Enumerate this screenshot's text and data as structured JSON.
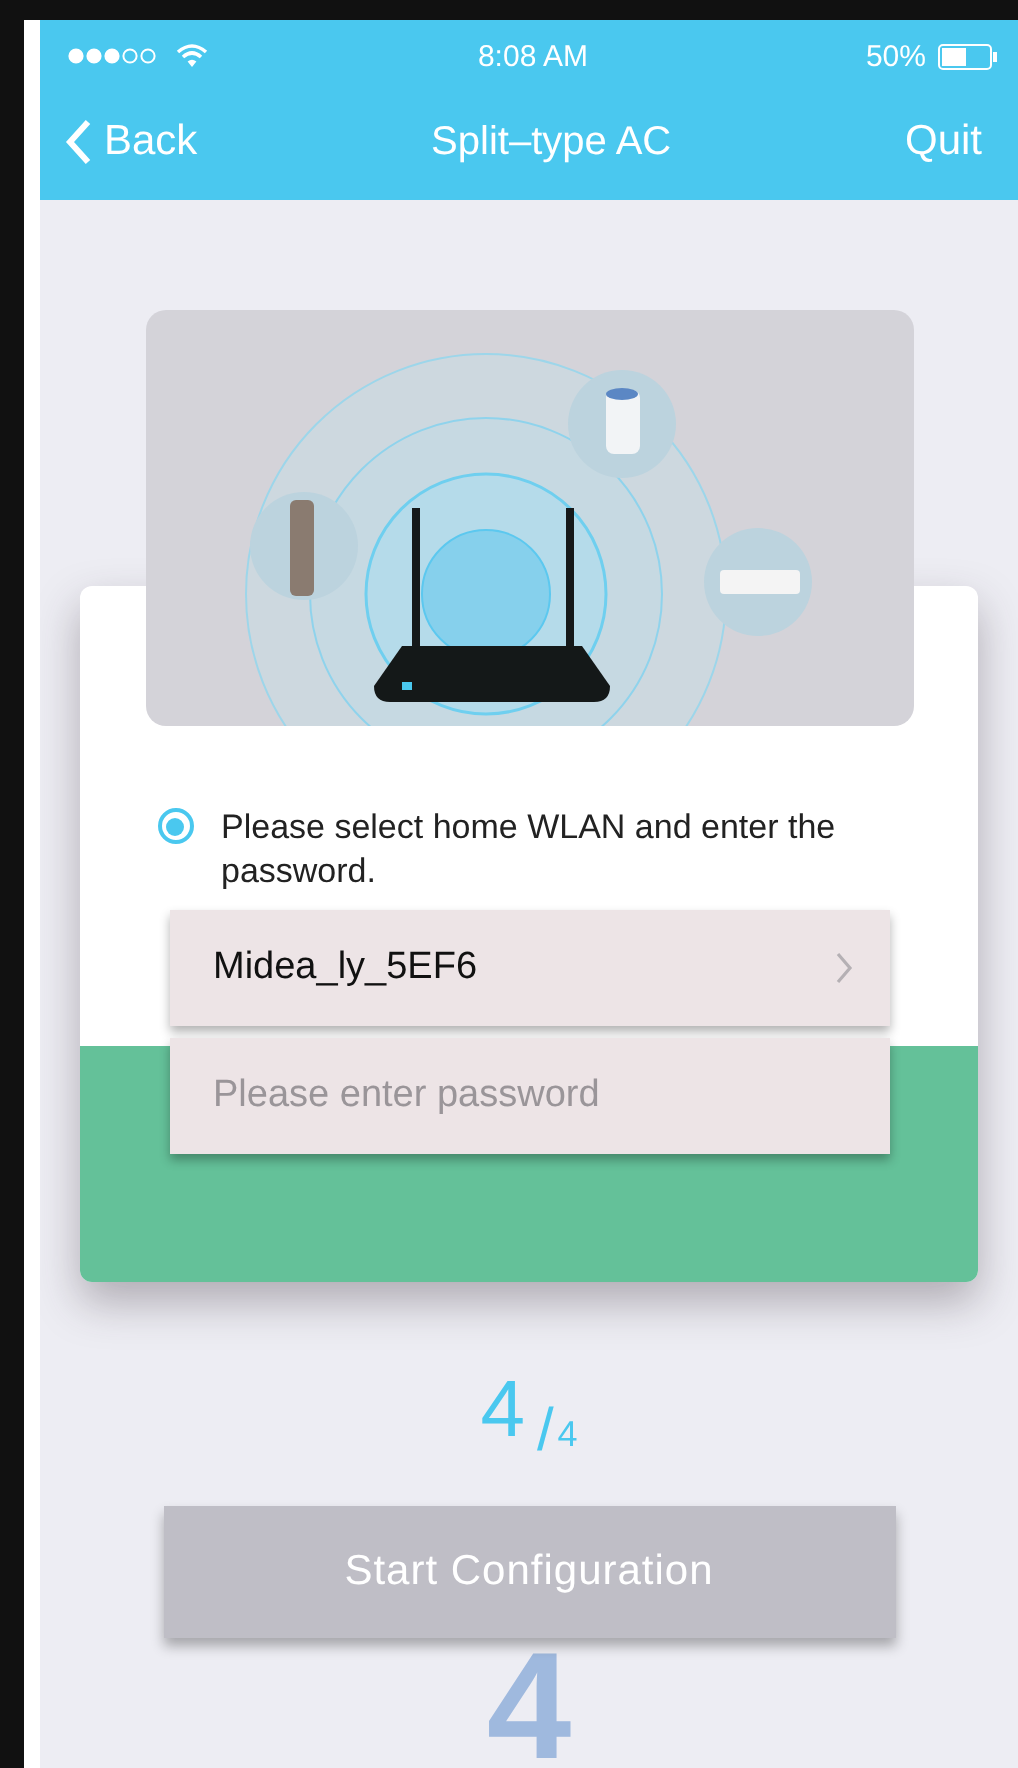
{
  "status_bar": {
    "time": "8:08 AM",
    "battery": "50%"
  },
  "nav": {
    "back": "Back",
    "title": "Split–type AC",
    "action": "Quit"
  },
  "instruction": {
    "text": "Please select home WLAN and enter the password.",
    "selected": true
  },
  "network": {
    "value": "Midea_ly_5EF6"
  },
  "password": {
    "placeholder": "Please enter password"
  },
  "step": {
    "current": "4",
    "separator": "/",
    "total": "4",
    "background_numeral": "4"
  },
  "start_button": {
    "label": "Start Configuration",
    "disabled": true
  }
}
